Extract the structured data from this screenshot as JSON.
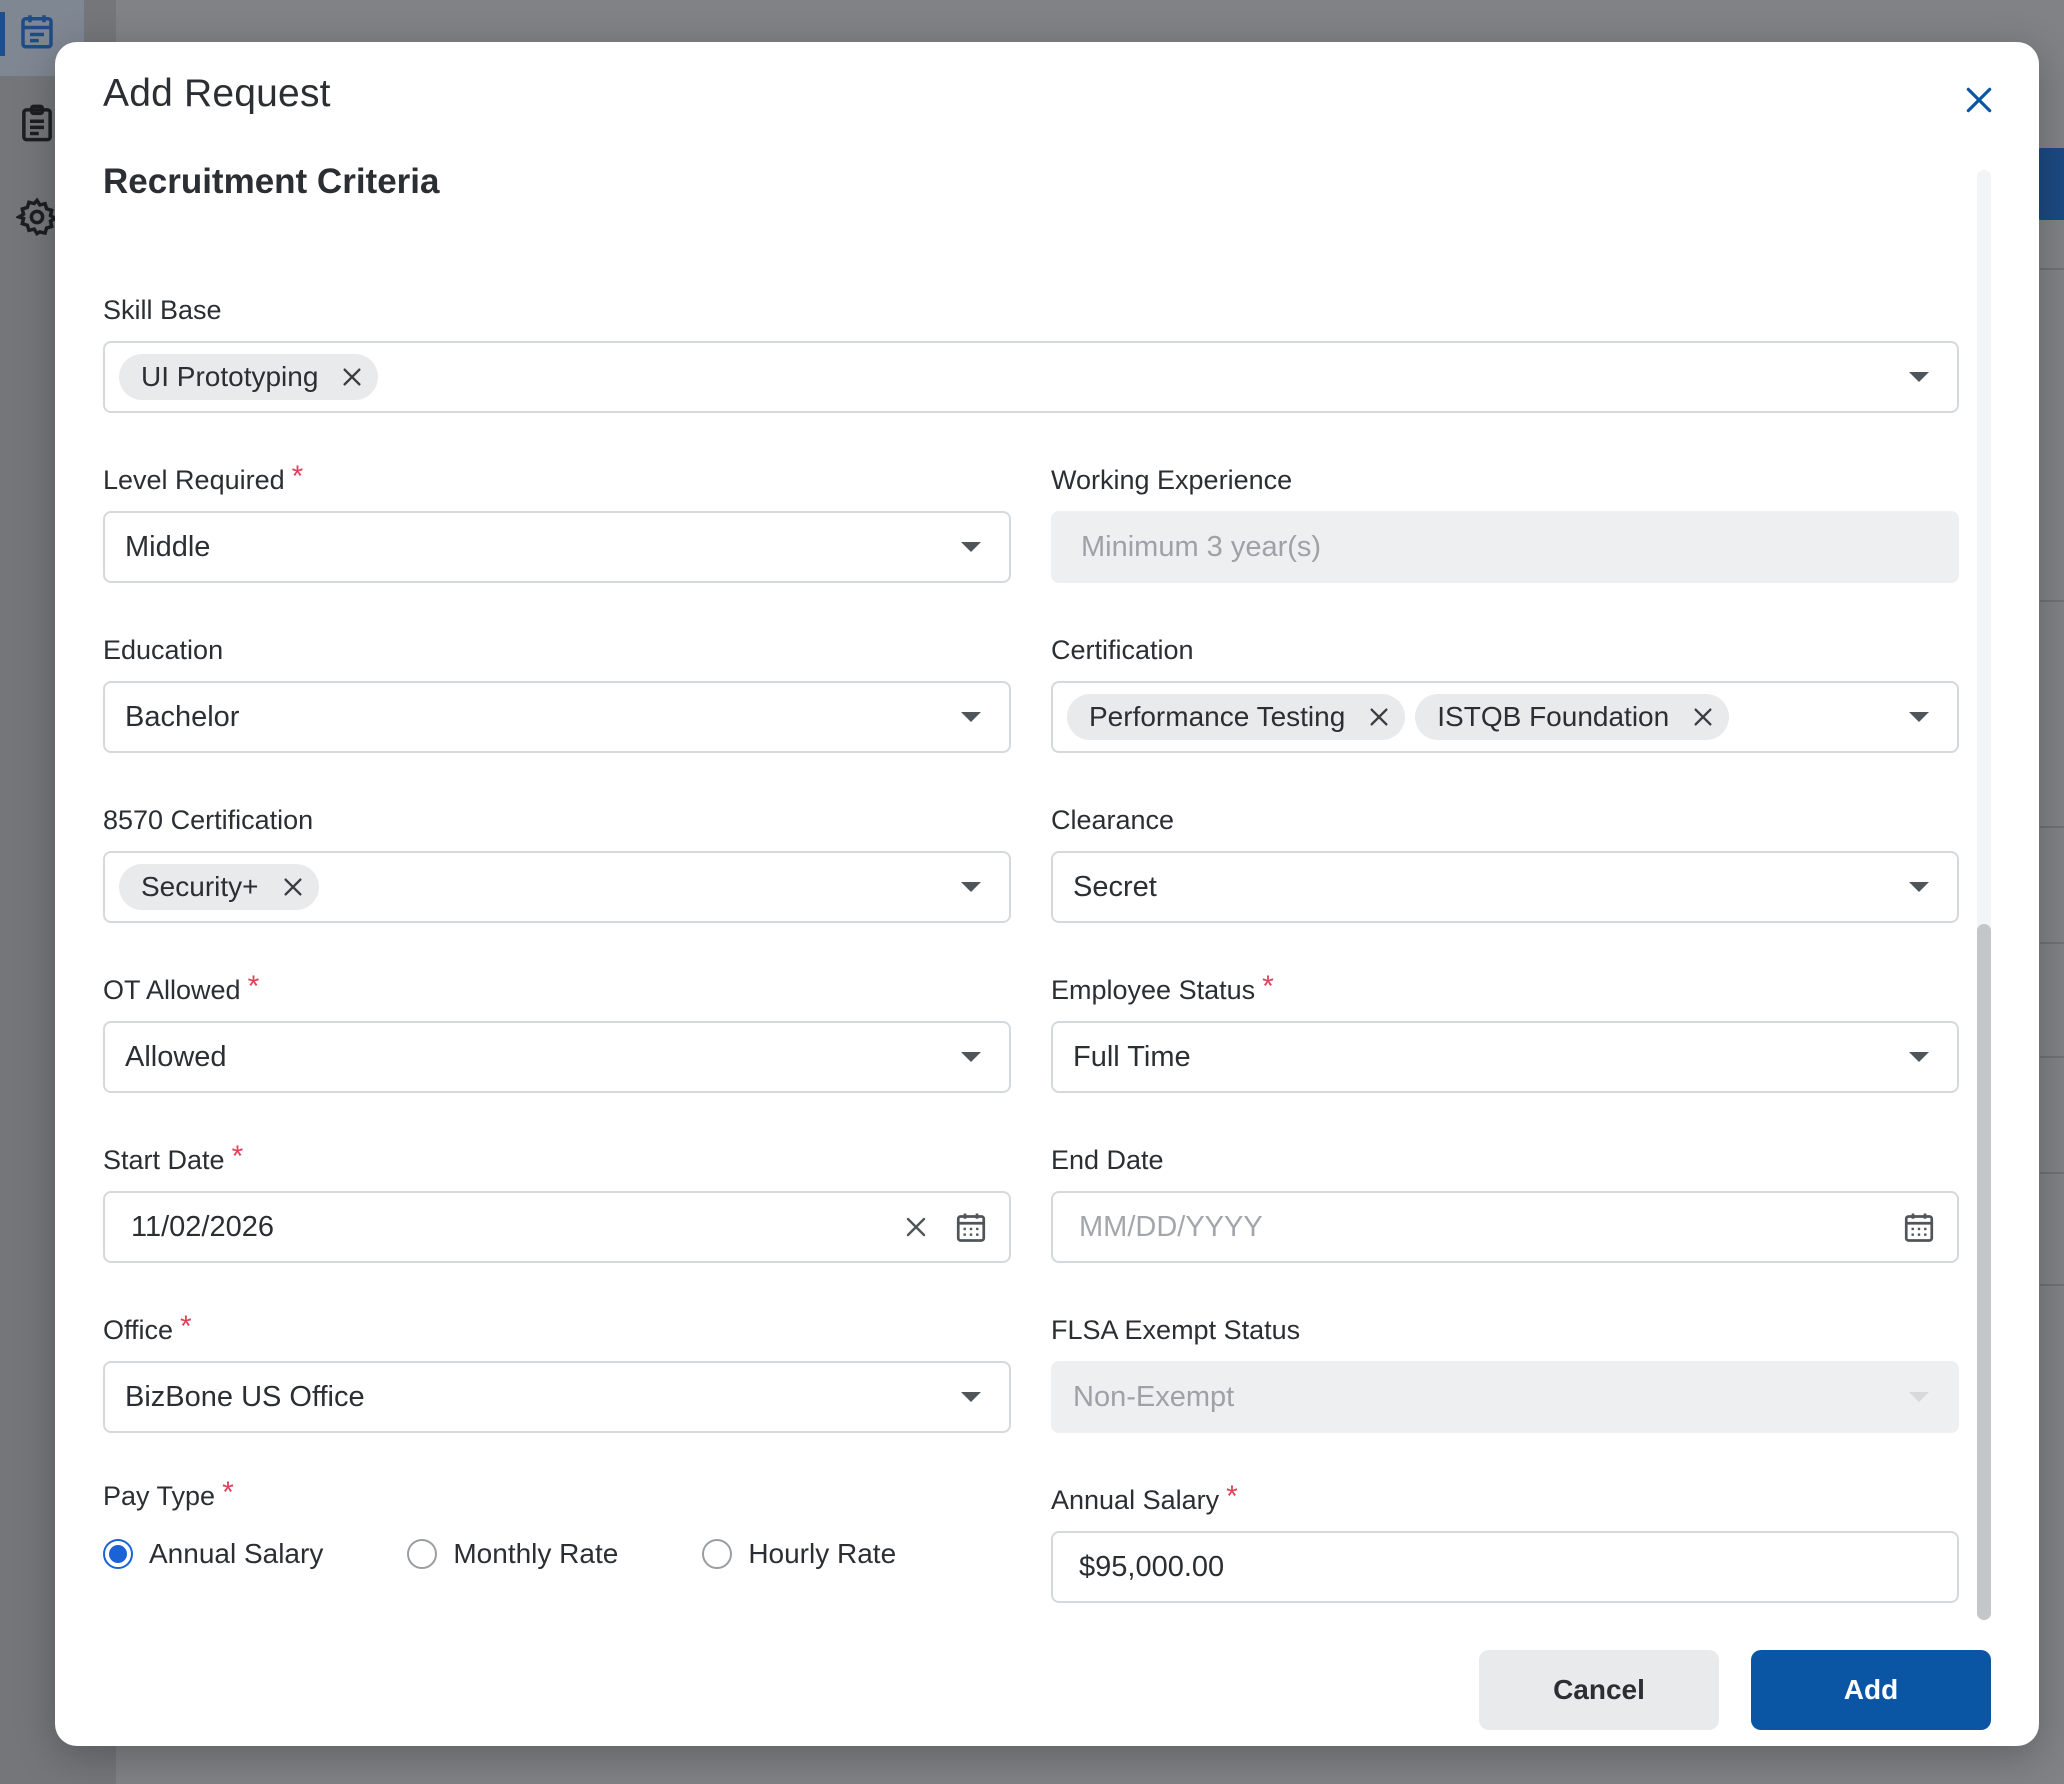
{
  "modal": {
    "title": "Add Request",
    "section_title": "Recruitment Criteria"
  },
  "fields": {
    "skill_base": {
      "label": "Skill Base",
      "chips": [
        "UI Prototyping"
      ]
    },
    "level_required": {
      "label": "Level Required",
      "required": "*",
      "value": "Middle"
    },
    "working_experience": {
      "label": "Working Experience",
      "placeholder": "Minimum 3 year(s)"
    },
    "education": {
      "label": "Education",
      "value": "Bachelor"
    },
    "certification": {
      "label": "Certification",
      "chips": [
        "Performance Testing",
        "ISTQB Foundation"
      ]
    },
    "cert_8570": {
      "label": "8570 Certification",
      "chips": [
        "Security+"
      ]
    },
    "clearance": {
      "label": "Clearance",
      "value": "Secret"
    },
    "ot_allowed": {
      "label": "OT Allowed",
      "required": "*",
      "value": "Allowed"
    },
    "employee_status": {
      "label": "Employee Status",
      "required": "*",
      "value": "Full Time"
    },
    "start_date": {
      "label": "Start Date",
      "required": "*",
      "value": "11/02/2026"
    },
    "end_date": {
      "label": "End Date",
      "placeholder": "MM/DD/YYYY"
    },
    "office": {
      "label": "Office",
      "required": "*",
      "value": "BizBone US Office"
    },
    "flsa": {
      "label": "FLSA Exempt Status",
      "value": "Non-Exempt"
    },
    "pay_type": {
      "label": "Pay Type",
      "required": "*",
      "options": [
        "Annual Salary",
        "Monthly Rate",
        "Hourly Rate"
      ],
      "selected": "Annual Salary"
    },
    "annual_salary": {
      "label": "Annual Salary",
      "required": "*",
      "value": "$95,000.00"
    }
  },
  "buttons": {
    "cancel": "Cancel",
    "add": "Add"
  },
  "colors": {
    "primary": "#0b56a4",
    "required": "#e0405a",
    "radio": "#1a63d6"
  },
  "icons": [
    "calendar-icon",
    "clipboard-icon",
    "gear-icon",
    "close-icon",
    "chevron-down-icon",
    "calendar-picker-icon"
  ]
}
